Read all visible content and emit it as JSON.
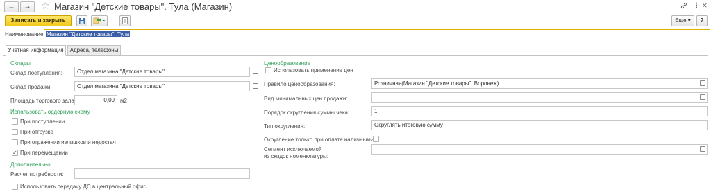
{
  "header": {
    "title": "Магазин \"Детские товары\". Тула (Магазин)",
    "back_icon": "←",
    "forward_icon": "→",
    "star_icon": "☆",
    "link_icon": "🔗",
    "menu_icon": "⋮",
    "close_icon": "×"
  },
  "toolbar": {
    "save_close_label": "Записать и закрыть",
    "more_label": "Еще",
    "more_chevron": "▾",
    "help_label": "?"
  },
  "name": {
    "label": "Наименование:",
    "value": "Магазин \"Детские товары\". Тула"
  },
  "tabs": [
    {
      "label": "Учетная информация"
    },
    {
      "label": "Адреса, телефоны"
    }
  ],
  "left": {
    "warehouses_section": "Склады",
    "receipt_label": "Склад поступления:",
    "receipt_value": "Отдел магазина \"Детские товары\"",
    "sales_label": "Склад продажи:",
    "sales_value": "Отдел магазина \"Детские товары\"",
    "area_label": "Площадь торгового зала:",
    "area_value": "0,00",
    "area_unit": "м2",
    "order_scheme_section": "Использовать ордерную схему",
    "order_options": [
      {
        "label": "При поступлении",
        "checked": false
      },
      {
        "label": "При отгрузке",
        "checked": false
      },
      {
        "label": "При отражении излишков и недостач",
        "checked": false
      },
      {
        "label": "При перемещении",
        "checked": true
      }
    ],
    "additional_section": "Дополнительно",
    "needs_label": "Расчет потребности:",
    "needs_value": "",
    "transfer_label": "Использовать передачу ДС в центральный офис"
  },
  "right": {
    "pricing_section": "Ценообразование",
    "use_prices_label": "Использовать применение цен",
    "rule_label": "Правило ценообразования:",
    "rule_value": "Розничная(Магазин \"Детские товары\". Воронеж)",
    "min_price_label": "Вид минимальных цен продажи:",
    "min_price_value": "",
    "rounding_order_label": "Порядок округления суммы чека:",
    "rounding_order_value": "1",
    "rounding_type_label": "Тип округления:",
    "rounding_type_value": "Округлять итоговую сумму",
    "cash_only_label": "Округление только при оплате наличными:",
    "segment_label_line1": "Сегмент исключаемой",
    "segment_label_line2": "из скидок номенклатуры:",
    "segment_value": ""
  }
}
